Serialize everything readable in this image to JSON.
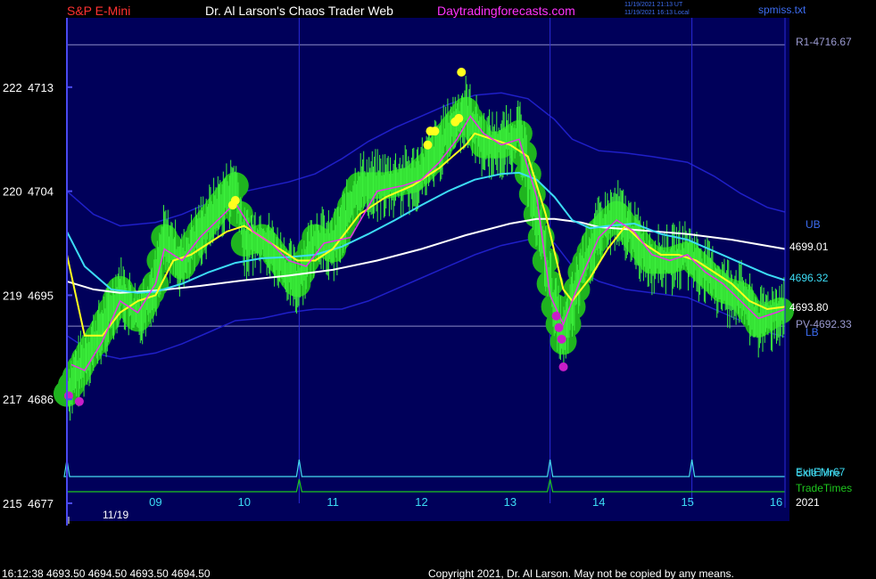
{
  "header": {
    "symbol": "S&P E-Mini",
    "site": "Dr. Al Larson's Chaos Trader Web",
    "url": "Daytradingforecasts.com",
    "timestamp_ut": "11/19/2021 21:13 UT",
    "timestamp_local": "11/19/2021 16:13 Local",
    "file": "spmiss.txt"
  },
  "footer": {
    "quote": "16:12:38  4693.50 4694.50 4693.50 4694.50",
    "copyright": "Copyright 2021, Dr. Al Larson. May not be copied by any means."
  },
  "colors": {
    "background": "#000000",
    "plot_bg": "#00005a",
    "bands": "#1f1fc8",
    "price_fill": "#1fb41f",
    "price_ticks": "#3cf03c",
    "fast_ma": "#e632e6",
    "mid_ma": "#ffff1e",
    "slow_ma": "#3cdcf5",
    "pivot_ma": "#ffffff",
    "level_line": "#8c8cc8",
    "forecast": "#46dcf0",
    "trade_times": "#1ec81e",
    "red_text": "#ff3232",
    "magenta_text": "#ff32ff"
  },
  "chart_data": {
    "type": "line",
    "x_unit": "hour of day (11/19/2021 session)",
    "xlim": [
      8.0,
      16.1
    ],
    "x_tick_labels": [
      "09",
      "10",
      "11",
      "12",
      "13",
      "14",
      "15",
      "16"
    ],
    "x_tick_values": [
      9,
      10,
      11,
      12,
      13,
      14,
      15,
      16
    ],
    "date_label": "11/19",
    "year_label": "2021",
    "ylim": [
      4677,
      4719
    ],
    "y_tick_values": [
      4713,
      4704,
      4695,
      4686,
      4677
    ],
    "y_tick_labels": [
      {
        "level": "222",
        "price": "4713"
      },
      {
        "level": "220",
        "price": "4704"
      },
      {
        "level": "219",
        "price": "4695"
      },
      {
        "level": "217",
        "price": "4686"
      },
      {
        "level": "215",
        "price": "4677"
      }
    ],
    "reference_lines": [
      {
        "name": "R1",
        "label": "R1-4716.67",
        "value": 4716.67
      },
      {
        "name": "PV",
        "label": "PV-4692.33",
        "value": 4692.33
      }
    ],
    "band_labels": {
      "upper": "UB",
      "lower": "LB"
    },
    "vertical_markers": [
      10.62,
      13.45,
      15.05
    ],
    "price_series": {
      "name": "price",
      "x": [
        8.0,
        8.2,
        8.4,
        8.6,
        8.8,
        9.0,
        9.1,
        9.3,
        9.5,
        9.7,
        9.9,
        10.0,
        10.2,
        10.4,
        10.6,
        10.8,
        11.0,
        11.3,
        11.6,
        11.9,
        12.1,
        12.3,
        12.5,
        12.7,
        12.9,
        13.1,
        13.3,
        13.5,
        13.6,
        13.8,
        14.0,
        14.2,
        14.4,
        14.6,
        14.8,
        15.0,
        15.2,
        15.4,
        15.6,
        15.8,
        16.0,
        16.1
      ],
      "y": [
        4686.5,
        4689.5,
        4692.0,
        4695.5,
        4693.0,
        4696.0,
        4700.0,
        4697.5,
        4700.5,
        4702.5,
        4704.5,
        4699.5,
        4700.0,
        4698.0,
        4696.0,
        4700.0,
        4699.0,
        4704.5,
        4704.5,
        4705.0,
        4706.5,
        4709.0,
        4711.0,
        4708.0,
        4708.0,
        4709.0,
        4702.0,
        4694.0,
        4691.0,
        4697.0,
        4700.5,
        4702.0,
        4700.0,
        4698.0,
        4698.0,
        4698.5,
        4697.0,
        4695.5,
        4695.0,
        4692.5,
        4693.5,
        4693.8
      ]
    },
    "series": [
      {
        "name": "fast_ma",
        "color": "#e632e6",
        "x": [
          8.05,
          8.2,
          8.4,
          8.6,
          8.8,
          9.0,
          9.1,
          9.3,
          9.5,
          9.7,
          9.9,
          10.1,
          10.3,
          10.5,
          10.7,
          10.9,
          11.2,
          11.5,
          11.8,
          12.0,
          12.2,
          12.4,
          12.55,
          12.7,
          12.9,
          13.1,
          13.3,
          13.45,
          13.6,
          13.8,
          14.0,
          14.2,
          14.4,
          14.6,
          14.8,
          15.0,
          15.2,
          15.4,
          15.6,
          15.8,
          16.0,
          16.1
        ],
        "y": [
          4689.0,
          4688.5,
          4691.0,
          4694.5,
          4693.5,
          4696.0,
          4699.0,
          4698.0,
          4700.0,
          4701.5,
          4703.0,
          4700.5,
          4699.5,
          4698.0,
          4697.5,
          4699.5,
          4700.0,
          4704.0,
          4704.5,
          4705.0,
          4706.5,
          4708.5,
          4710.5,
          4709.0,
          4708.0,
          4708.5,
          4703.5,
          4695.0,
          4692.5,
          4696.5,
          4700.0,
          4701.5,
          4700.5,
          4698.5,
          4698.0,
          4698.5,
          4697.0,
          4696.0,
          4694.5,
          4693.0,
          4693.5,
          4693.8
        ]
      },
      {
        "name": "mid_ma",
        "color": "#ffff1e",
        "x": [
          8.0,
          8.2,
          8.4,
          8.6,
          8.8,
          9.0,
          9.2,
          9.4,
          9.6,
          9.8,
          10.0,
          10.2,
          10.4,
          10.6,
          10.8,
          11.0,
          11.3,
          11.6,
          11.9,
          12.2,
          12.5,
          12.6,
          12.8,
          13.0,
          13.2,
          13.4,
          13.6,
          13.7,
          13.9,
          14.1,
          14.3,
          14.5,
          14.7,
          14.9,
          15.1,
          15.3,
          15.5,
          15.7,
          15.9,
          16.1
        ],
        "y": [
          4698.5,
          4691.5,
          4691.5,
          4693.5,
          4694.5,
          4695.0,
          4698.0,
          4698.5,
          4699.5,
          4700.5,
          4701.0,
          4700.0,
          4699.0,
          4698.0,
          4698.0,
          4699.0,
          4702.0,
          4703.5,
          4704.5,
          4706.0,
          4708.0,
          4709.0,
          4708.5,
          4708.0,
          4707.0,
          4702.0,
          4695.5,
          4694.5,
          4696.5,
          4699.0,
          4701.0,
          4699.5,
          4698.5,
          4698.5,
          4698.0,
          4697.0,
          4696.0,
          4694.5,
          4693.8,
          4694.0
        ]
      },
      {
        "name": "slow_ma",
        "color": "#3cdcf5",
        "x": [
          8.0,
          8.2,
          8.5,
          8.8,
          9.0,
          9.3,
          9.6,
          9.9,
          10.2,
          10.5,
          10.8,
          11.1,
          11.4,
          11.7,
          12.0,
          12.3,
          12.6,
          12.9,
          13.1,
          13.3,
          13.5,
          13.7,
          13.9,
          14.1,
          14.4,
          14.7,
          15.0,
          15.3,
          15.6,
          15.9,
          16.1
        ],
        "y": [
          4700.5,
          4697.5,
          4695.5,
          4695.2,
          4695.3,
          4696.0,
          4697.0,
          4697.8,
          4698.2,
          4698.3,
          4698.5,
          4699.2,
          4700.3,
          4701.5,
          4702.8,
          4704.0,
          4705.0,
          4705.5,
          4705.6,
          4705.0,
          4703.5,
          4701.5,
          4700.8,
          4701.0,
          4701.2,
          4700.3,
          4699.8,
          4698.8,
          4697.8,
          4696.8,
          4696.3
        ]
      },
      {
        "name": "pivot_ma",
        "color": "#ffffff",
        "x": [
          8.0,
          8.3,
          8.6,
          9.0,
          9.5,
          10.0,
          10.5,
          11.0,
          11.5,
          12.0,
          12.5,
          13.0,
          13.3,
          13.5,
          13.8,
          14.0,
          14.5,
          15.0,
          15.5,
          16.1
        ],
        "y": [
          4696.2,
          4695.5,
          4695.2,
          4695.4,
          4695.8,
          4696.3,
          4696.7,
          4697.2,
          4698.0,
          4699.0,
          4700.2,
          4701.2,
          4701.6,
          4701.6,
          4701.3,
          4700.9,
          4700.6,
          4700.3,
          4699.8,
          4699.0
        ]
      },
      {
        "name": "upper_band",
        "color": "#1f1fc8",
        "x": [
          8.0,
          8.3,
          8.6,
          9.0,
          9.3,
          9.6,
          9.9,
          10.2,
          10.5,
          10.8,
          11.1,
          11.4,
          11.7,
          12.0,
          12.3,
          12.6,
          12.9,
          13.2,
          13.5,
          13.7,
          14.0,
          14.3,
          14.6,
          15.0,
          15.3,
          15.6,
          15.9,
          16.1
        ],
        "y": [
          4704.0,
          4702.0,
          4701.0,
          4701.3,
          4702.0,
          4703.0,
          4703.8,
          4704.3,
          4704.8,
          4705.5,
          4706.8,
          4708.3,
          4709.5,
          4710.5,
          4711.5,
          4712.3,
          4712.5,
          4712.0,
          4710.2,
          4708.5,
          4707.5,
          4707.3,
          4707.0,
          4706.5,
          4705.3,
          4703.8,
          4702.6,
          4702.2
        ]
      },
      {
        "name": "lower_band",
        "color": "#1f1fc8",
        "x": [
          8.0,
          8.3,
          8.6,
          9.0,
          9.3,
          9.6,
          9.9,
          10.2,
          10.5,
          10.8,
          11.1,
          11.4,
          11.7,
          12.0,
          12.3,
          12.6,
          12.9,
          13.2,
          13.5,
          13.7,
          14.0,
          14.3,
          14.6,
          15.0,
          15.3,
          15.6,
          15.9,
          16.1
        ],
        "y": [
          4691.5,
          4690.0,
          4689.5,
          4690.0,
          4690.8,
          4691.8,
          4692.8,
          4693.0,
          4693.5,
          4693.8,
          4693.8,
          4694.5,
          4695.5,
          4696.5,
          4697.5,
          4698.5,
          4699.3,
          4699.8,
          4699.5,
          4697.5,
          4696.2,
          4695.5,
          4695.2,
          4694.8,
          4693.8,
          4692.8,
          4691.8,
          4691.4
        ]
      }
    ],
    "high_markers": [
      {
        "x": 9.87,
        "y": 4702.8
      },
      {
        "x": 9.9,
        "y": 4703.2
      },
      {
        "x": 12.07,
        "y": 4708.0
      },
      {
        "x": 12.1,
        "y": 4709.2
      },
      {
        "x": 12.15,
        "y": 4709.2
      },
      {
        "x": 12.38,
        "y": 4710.0
      },
      {
        "x": 12.42,
        "y": 4710.3
      },
      {
        "x": 12.45,
        "y": 4714.3
      }
    ],
    "low_markers": [
      {
        "x": 8.02,
        "y": 4686.3
      },
      {
        "x": 8.14,
        "y": 4685.8
      },
      {
        "x": 13.52,
        "y": 4693.2
      },
      {
        "x": 13.55,
        "y": 4692.2
      },
      {
        "x": 13.58,
        "y": 4691.2
      },
      {
        "x": 13.6,
        "y": 4688.8
      }
    ],
    "last_values": [
      {
        "label": "4699.01",
        "value": 4699.01,
        "color": "#ffffff"
      },
      {
        "label": "4696.32",
        "value": 4696.32,
        "color": "#3cdcf5"
      },
      {
        "label": "4693.80",
        "value": 4693.8,
        "color": "#ffffff"
      }
    ],
    "forecast_line": {
      "label": "SideTime",
      "label_overlap": "ExitEMr67",
      "spikes_x": [
        8.0,
        10.62,
        13.45,
        15.05
      ]
    },
    "trade_times_line": {
      "label": "TradeTimes",
      "spikes_x": [
        10.62,
        13.45
      ]
    }
  }
}
